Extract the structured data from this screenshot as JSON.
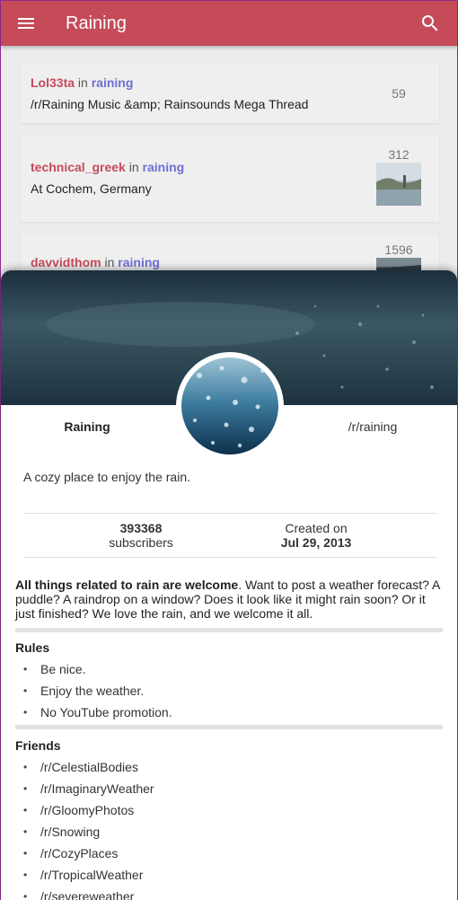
{
  "appbar": {
    "title": "Raining"
  },
  "posts": [
    {
      "author": "Lol33ta",
      "in_label": "in",
      "subreddit": "raining",
      "title": "/r/Raining Music &amp; Rainsounds Mega Thread",
      "score": "59"
    },
    {
      "author": "technical_greek",
      "in_label": "in",
      "subreddit": "raining",
      "title": "At Cochem, Germany",
      "score": "312"
    },
    {
      "author": "davvidthom",
      "in_label": "in",
      "subreddit": "raining",
      "title": "",
      "score": "1596"
    }
  ],
  "sidebar": {
    "name": "Raining",
    "path": "/r/raining",
    "tagline": "A cozy place to enjoy the rain.",
    "subscribers_count": "393368",
    "subscribers_label": "subscribers",
    "created_label": "Created on",
    "created_date": "Jul 29, 2013",
    "description_bold": "All things related to rain are welcome",
    "description_rest": ". Want to post a weather forecast? A puddle? A raindrop on a window? Does it look like it might rain soon? Or it just finished? We love the rain, and we welcome it all.",
    "bullet": "•",
    "rules_title": "Rules",
    "rules": [
      "Be nice.",
      "Enjoy the weather.",
      "No YouTube promotion."
    ],
    "friends_title": "Friends",
    "friends": [
      "/r/CelestialBodies",
      "/r/ImaginaryWeather",
      "/r/GloomyPhotos",
      "/r/Snowing",
      "/r/CozyPlaces",
      "/r/TropicalWeather",
      "/r/severeweather"
    ]
  },
  "colors": {
    "appbar": "#c54b59",
    "author": "#c54b59",
    "subreddit": "#6f6fd6"
  },
  "icons": {
    "menu": "menu-icon",
    "search": "search-icon"
  }
}
